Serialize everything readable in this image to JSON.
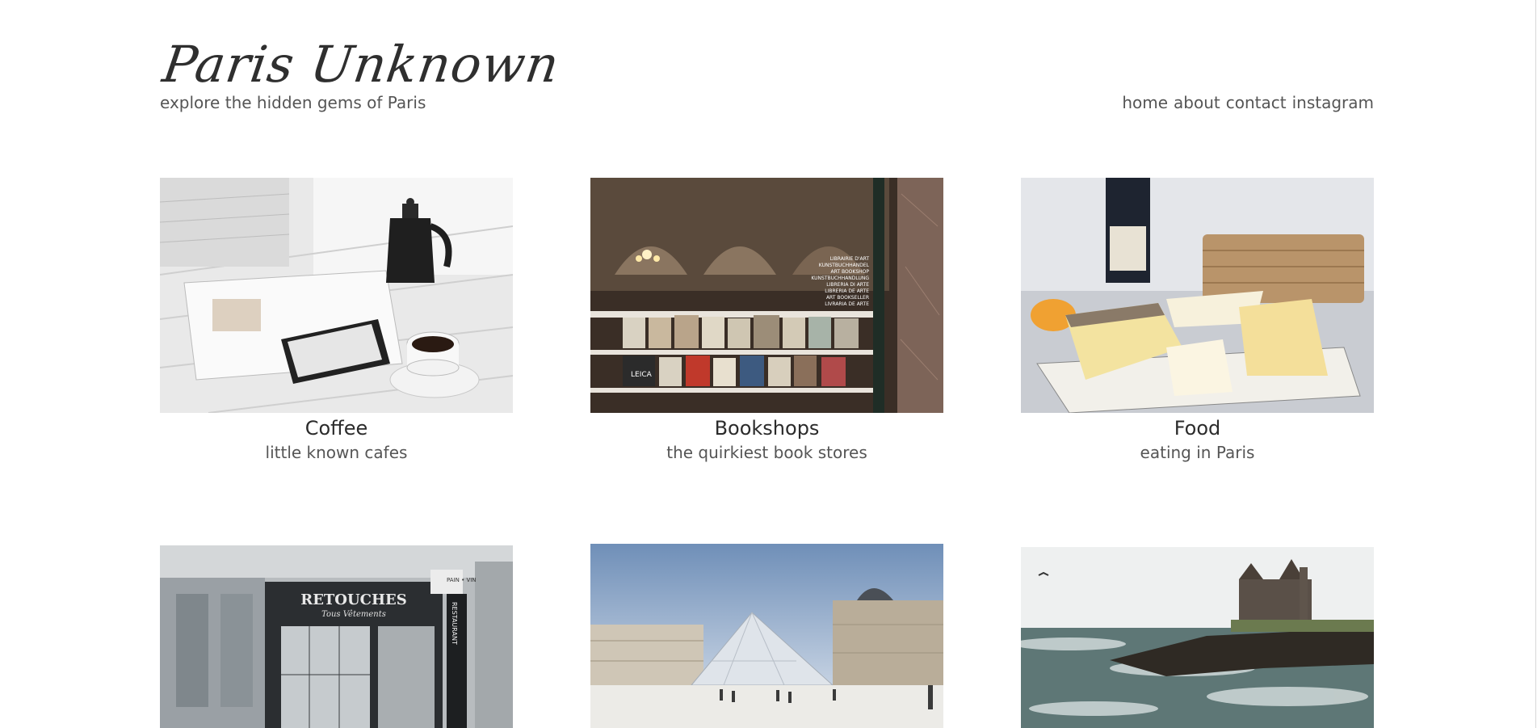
{
  "header": {
    "logo": "Paris Unknown",
    "tagline": "explore the hidden gems of Paris"
  },
  "nav": {
    "items": [
      "home",
      "about",
      "contact",
      "instagram"
    ]
  },
  "cards": [
    {
      "title": "Coffee",
      "subtitle": "little known cafes",
      "image": "coffee-table-photo"
    },
    {
      "title": "Bookshops",
      "subtitle": "the quirkiest book stores",
      "image": "bookshop-window-photo"
    },
    {
      "title": "Food",
      "subtitle": "eating in Paris",
      "image": "cheese-plate-photo"
    },
    {
      "title": "",
      "subtitle": "",
      "image": "retouches-storefront-photo",
      "photo_text": {
        "sign": "RETOUCHES",
        "subsign": "Tous Vêtements",
        "vertical": "RESTAURANT",
        "corner": "PAIN • VIN"
      }
    },
    {
      "title": "",
      "subtitle": "",
      "image": "louvre-pyramid-photo"
    },
    {
      "title": "",
      "subtitle": "",
      "image": "coastal-castle-photo"
    }
  ],
  "photo_text": {
    "bookshop_sign": [
      "LIBRAIRIE D'ART",
      "KUNSTBUCHHANDEL",
      "ART BOOKSHOP",
      "KUNSTBUCHHANDLUNG",
      "LIBRERIA DI ARTE",
      "LIBRERIA DE ARTE",
      "ART BOOKSELLER",
      "LIVRARIA DE ARTE"
    ],
    "book_spine": "LEICA"
  }
}
